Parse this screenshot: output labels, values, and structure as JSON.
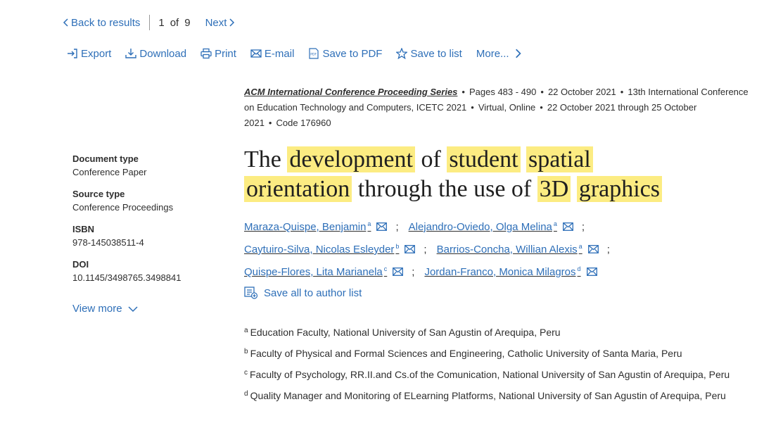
{
  "nav": {
    "back_label": "Back to results",
    "current": "1",
    "of": "of",
    "total": "9",
    "next_label": "Next"
  },
  "toolbar": {
    "export": "Export",
    "download": "Download",
    "print": "Print",
    "email": "E-mail",
    "save_pdf": "Save to PDF",
    "save_list": "Save to list",
    "more": "More..."
  },
  "source": {
    "series": "ACM International Conference Proceeding Series",
    "pages": "Pages 483 - 490",
    "date": "22 October 2021",
    "conference": "13th International Conference on Education Technology and Computers, ICETC 2021",
    "location": "Virtual, Online",
    "dates_range": "22 October 2021 through 25 October 2021",
    "code": "Code 176960"
  },
  "meta": {
    "doc_type_label": "Document type",
    "doc_type": "Conference Paper",
    "source_type_label": "Source type",
    "source_type": "Conference Proceedings",
    "isbn_label": "ISBN",
    "isbn": "978-145038511-4",
    "doi_label": "DOI",
    "doi": "10.1145/3498765.3498841",
    "view_more": "View more"
  },
  "title": {
    "w1": "The",
    "w2": "development",
    "w3": "of",
    "w4": "student",
    "w5": "spatial",
    "w6": "orientation",
    "w7": "through the use of",
    "w8": "3D",
    "w9": "graphics"
  },
  "authors": [
    {
      "name": "Maraza-Quispe, Benjamin",
      "sup": "a"
    },
    {
      "name": "Alejandro-Oviedo, Olga Melina",
      "sup": "a"
    },
    {
      "name": "Caytuiro-Silva, Nicolas Esleyder",
      "sup": "b"
    },
    {
      "name": "Barrios-Concha, Willian Alexis",
      "sup": "a"
    },
    {
      "name": "Quispe-Flores, Lita Marianela",
      "sup": "c"
    },
    {
      "name": "Jordan-Franco, Monica Milagros",
      "sup": "d"
    }
  ],
  "separator": ";",
  "save_all": "Save all to author list",
  "affiliations": [
    {
      "sup": "a",
      "text": "Education Faculty, National University of San Agustin of Arequipa, Peru"
    },
    {
      "sup": "b",
      "text": "Faculty of Physical and Formal Sciences and Engineering, Catholic University of Santa Maria, Peru"
    },
    {
      "sup": "c",
      "text": "Faculty of Psychology, RR.II.and Cs.of the Comunication, National University of San Agustin of Arequipa, Peru"
    },
    {
      "sup": "d",
      "text": "Quality Manager and Monitoring of ELearning Platforms, National University of San Agustin of Arequipa, Peru"
    }
  ],
  "colors": {
    "link": "#2e6fb8",
    "highlight": "#fcec82",
    "text": "#2e2e2e"
  }
}
